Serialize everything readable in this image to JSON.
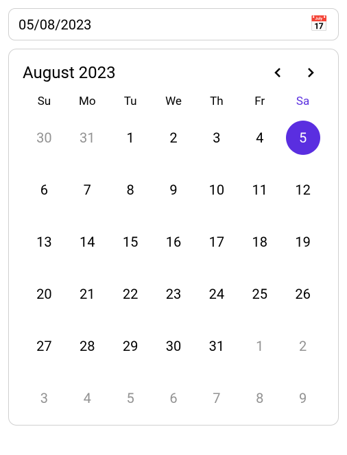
{
  "input": {
    "value": "05/08/2023",
    "icon": "📅"
  },
  "calendar": {
    "title": "August 2023",
    "weekdays": [
      "Su",
      "Mo",
      "Tu",
      "We",
      "Th",
      "Fr",
      "Sa"
    ],
    "today_weekday_index": 6,
    "days": [
      {
        "d": 30,
        "outside": true
      },
      {
        "d": 31,
        "outside": true
      },
      {
        "d": 1
      },
      {
        "d": 2
      },
      {
        "d": 3
      },
      {
        "d": 4
      },
      {
        "d": 5,
        "selected": true
      },
      {
        "d": 6
      },
      {
        "d": 7
      },
      {
        "d": 8
      },
      {
        "d": 9
      },
      {
        "d": 10
      },
      {
        "d": 11
      },
      {
        "d": 12
      },
      {
        "d": 13
      },
      {
        "d": 14
      },
      {
        "d": 15
      },
      {
        "d": 16
      },
      {
        "d": 17
      },
      {
        "d": 18
      },
      {
        "d": 19
      },
      {
        "d": 20
      },
      {
        "d": 21
      },
      {
        "d": 22
      },
      {
        "d": 23
      },
      {
        "d": 24
      },
      {
        "d": 25
      },
      {
        "d": 26
      },
      {
        "d": 27
      },
      {
        "d": 28
      },
      {
        "d": 29
      },
      {
        "d": 30
      },
      {
        "d": 31
      },
      {
        "d": 1,
        "outside": true
      },
      {
        "d": 2,
        "outside": true
      },
      {
        "d": 3,
        "outside": true
      },
      {
        "d": 4,
        "outside": true
      },
      {
        "d": 5,
        "outside": true
      },
      {
        "d": 6,
        "outside": true
      },
      {
        "d": 7,
        "outside": true
      },
      {
        "d": 8,
        "outside": true
      },
      {
        "d": 9,
        "outside": true
      }
    ]
  },
  "colors": {
    "accent": "#5A2EE0",
    "muted": "#929292"
  }
}
